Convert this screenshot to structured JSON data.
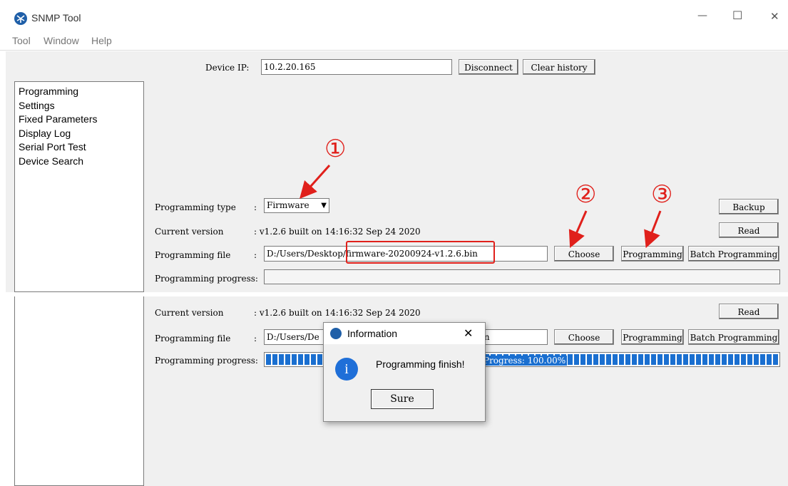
{
  "window": {
    "title": "SNMP Tool",
    "menu": [
      "Tool",
      "Window",
      "Help"
    ],
    "controls": {
      "minimize": "—",
      "maximize": "☐",
      "close": "✕"
    }
  },
  "device": {
    "ip_label": "Device IP:",
    "ip_value": "10.2.20.165",
    "disconnect": "Disconnect",
    "clear_history": "Clear history"
  },
  "sidebar": {
    "items": [
      "Programming",
      "Settings",
      "Fixed Parameters",
      "Display Log",
      "Serial Port Test",
      "Device Search"
    ]
  },
  "form": {
    "type_label": "Programming type",
    "colon": ":",
    "type_value": "Firmware",
    "version_label": "Current version",
    "version_value": ": v1.2.6 built on 14:16:32 Sep 24 2020",
    "file_label": "Programming file",
    "file_value": "D:/Users/Desktop/firmware-20200924-v1.2.6.bin",
    "progress_label": "Programming progress:",
    "backup": "Backup",
    "read": "Read",
    "choose": "Choose",
    "programming": "Programming",
    "batch": "Batch Programming"
  },
  "lower": {
    "version_label": "Current version",
    "version_value": ": v1.2.6 built on 14:16:32 Sep 24 2020",
    "read": "Read",
    "file_label": "Programming file",
    "file_value_left": "D:/Users/De",
    "file_value_right": "in",
    "choose": "Choose",
    "programming": "Programming",
    "batch": "Batch Programming",
    "progress_label": "Programming progress:",
    "progress_text": "Progress: 100.00%",
    "progress_fraction": 1.0
  },
  "dialog": {
    "title": "Information",
    "message": "Programming finish!",
    "button": "Sure",
    "close": "✕",
    "info_glyph": "i"
  },
  "annotations": {
    "step1": "①",
    "step2": "②",
    "step3": "③",
    "color": "#e0201b"
  }
}
